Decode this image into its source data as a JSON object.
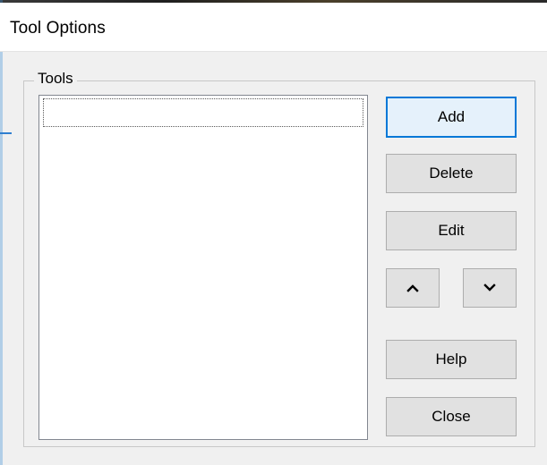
{
  "window": {
    "title": "Tool Options"
  },
  "tools_group": {
    "label": "Tools",
    "items": []
  },
  "buttons": {
    "add": "Add",
    "delete": "Delete",
    "edit": "Edit",
    "move_up_icon": "chevron-up-icon",
    "move_down_icon": "chevron-down-icon",
    "help": "Help",
    "close": "Close"
  },
  "colors": {
    "accent": "#0078d7",
    "dialog_bg": "#f0f0f0",
    "button_bg": "#e1e1e1"
  }
}
